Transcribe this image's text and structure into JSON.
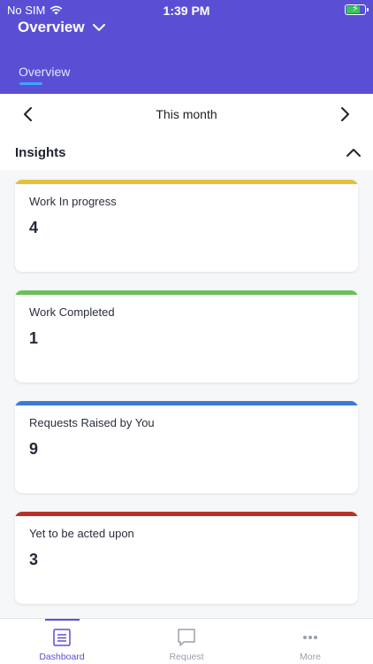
{
  "status_bar": {
    "carrier": "No SIM",
    "time": "1:39 PM",
    "battery_fill": 0.7
  },
  "header": {
    "title": "Overview",
    "tab_label": "Overview"
  },
  "period": {
    "label": "This month"
  },
  "insights": {
    "title": "Insights",
    "cards": [
      {
        "label": "Work In progress",
        "value": "4",
        "color": "#e2c23c"
      },
      {
        "label": "Work Completed",
        "value": "1",
        "color": "#6bbf59"
      },
      {
        "label": "Requests Raised by You",
        "value": "9",
        "color": "#3a7bd5"
      },
      {
        "label": "Yet to be acted upon",
        "value": "3",
        "color": "#b5342a"
      }
    ]
  },
  "bottom_nav": {
    "items": [
      {
        "label": "Dashboard",
        "icon": "dashboard-icon",
        "active": true
      },
      {
        "label": "Request",
        "icon": "chat-bubble-icon",
        "active": false
      },
      {
        "label": "More",
        "icon": "more-dots-icon",
        "active": false
      }
    ]
  },
  "colors": {
    "brand": "#5a4fd4",
    "accent": "#3ea6ff"
  }
}
